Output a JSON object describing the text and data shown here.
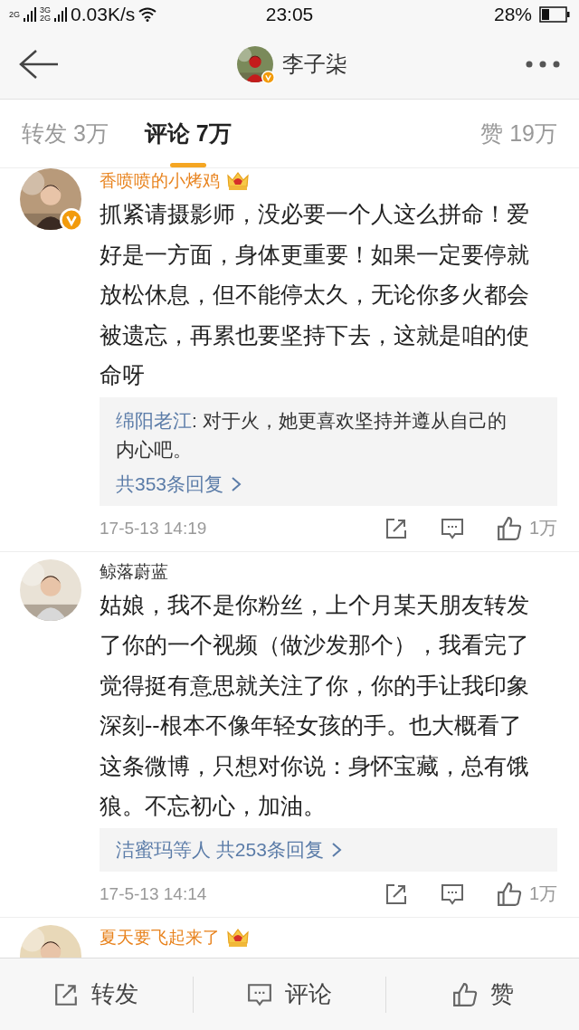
{
  "status_bar": {
    "sim1": "2G",
    "sim2_top": "3G",
    "sim2_bottom": "2G",
    "speed": "0.03K/s",
    "time": "23:05",
    "battery": "28%"
  },
  "header": {
    "title": "李子柒",
    "verified": true
  },
  "tabs": [
    {
      "label": "转发 3万",
      "selected": false
    },
    {
      "label": "评论 7万",
      "selected": true
    },
    {
      "label": "赞 19万",
      "selected": false
    }
  ],
  "comments": [
    {
      "name": "香喷喷的小烤鸡",
      "vip": true,
      "verified": true,
      "text": "抓紧请摄影师，没必要一个人这么拼命！爱好是一方面，身体更重要！如果一定要停就放松休息，但不能停太久，无论你多火都会被遗忘，再累也要坚持下去，这就是咱的使命呀",
      "reply": {
        "author": "绵阳老江",
        "text": ": 对于火，她更喜欢坚持并遵从自己的内心吧。"
      },
      "more_replies": "共353条回复",
      "time": "17-5-13 14:19",
      "likes": "1万"
    },
    {
      "name": "鲸落蔚蓝",
      "vip": false,
      "verified": false,
      "text": "姑娘，我不是你粉丝，上个月某天朋友转发了你的一个视频（做沙发那个），我看完了觉得挺有意思就关注了你，你的手让我印象深刻--根本不像年轻女孩的手。也大概看了这条微博，只想对你说：身怀宝藏，总有饿狼。不忘初心，加油。",
      "more_replies": "洁蜜玛等人 共253条回复",
      "time": "17-5-13 14:14",
      "likes": "1万"
    },
    {
      "name": "夏天要飞起来了",
      "vip": true,
      "verified": false
    }
  ],
  "bottom_bar": [
    {
      "kind": "repost",
      "label": "转发"
    },
    {
      "kind": "comment",
      "label": "评论"
    },
    {
      "kind": "like",
      "label": "赞"
    }
  ]
}
